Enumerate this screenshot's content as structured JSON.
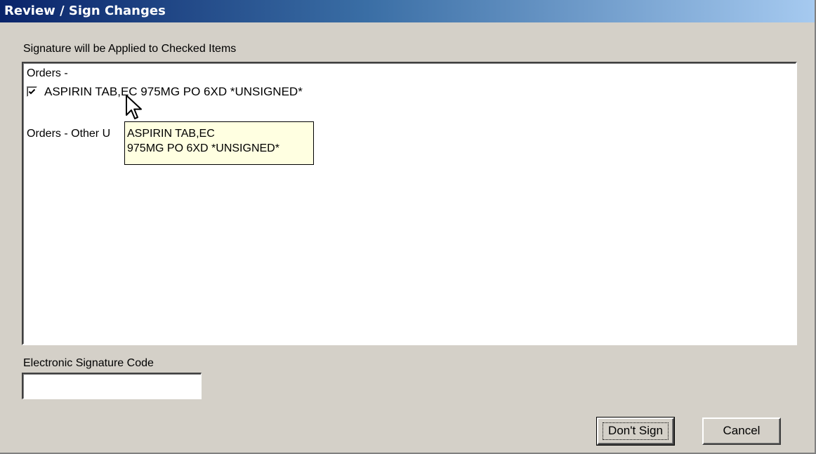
{
  "window": {
    "title": "Review / Sign Changes"
  },
  "instructions": "Signature will be Applied to Checked Items",
  "list": {
    "section_orders": "Orders -",
    "order_item": {
      "label": "ASPIRIN TAB,EC 975MG PO 6XD *UNSIGNED*",
      "checked": true
    },
    "section_other": "Orders - Other U"
  },
  "tooltip": {
    "line1": "ASPIRIN TAB,EC",
    "line2": "975MG PO 6XD *UNSIGNED*"
  },
  "signature": {
    "label": "Electronic Signature Code",
    "value": ""
  },
  "buttons": {
    "dont_sign": "Don't Sign",
    "cancel": "Cancel"
  },
  "icons": {
    "checkbox": "checkmark-icon",
    "cursor": "mouse-pointer-icon"
  },
  "colors": {
    "titlebar_start": "#0a246a",
    "titlebar_end": "#a6caf0",
    "tooltip_bg": "#ffffe1",
    "dialog_bg": "#d4d0c8"
  }
}
